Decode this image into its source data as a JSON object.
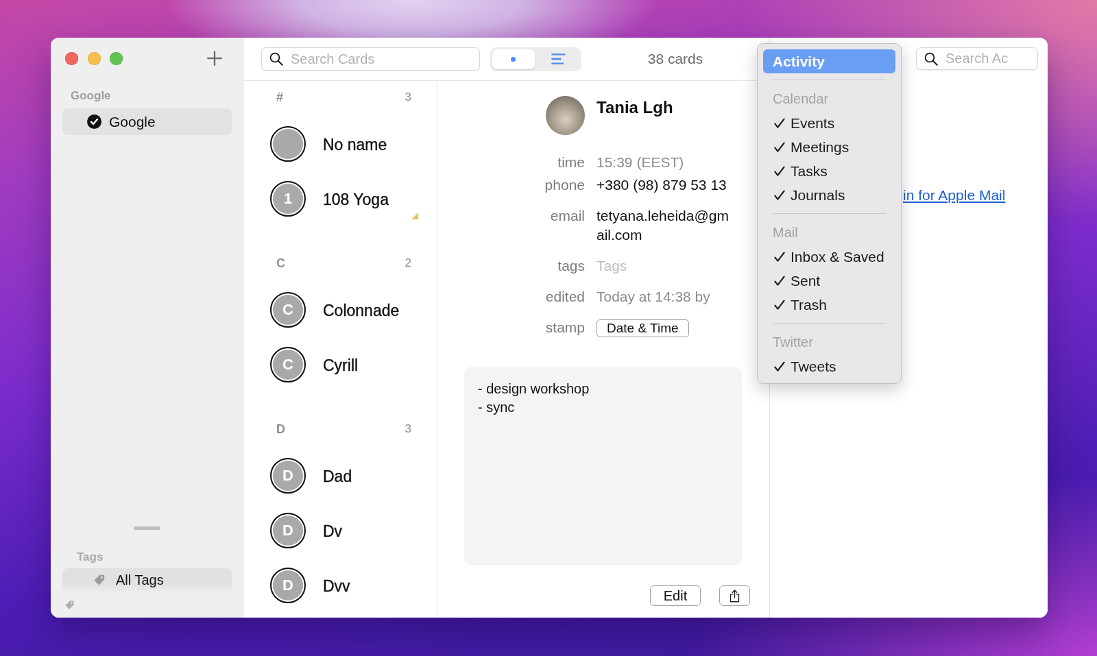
{
  "sidebar": {
    "accounts": {
      "title": "Google",
      "items": [
        {
          "label": "Google",
          "checked": true,
          "selected": true
        }
      ]
    },
    "tags": {
      "title": "Tags",
      "items": [
        {
          "label": "All Tags",
          "selected": true
        }
      ]
    }
  },
  "toolbar": {
    "search": {
      "placeholder": "Search Cards"
    },
    "view_modes": [
      {
        "kind": "dot",
        "selected": true
      },
      {
        "kind": "list",
        "selected": false
      }
    ],
    "count": "38 cards"
  },
  "card_list": {
    "sections": [
      {
        "letter": "#",
        "count": "3",
        "cards": [
          {
            "name": "No name",
            "marked": false
          },
          {
            "name": "108 Yoga",
            "initial": "1",
            "marked": true
          }
        ]
      },
      {
        "letter": "C",
        "count": "2",
        "cards": [
          {
            "name": "Colonnade",
            "initial": "C",
            "marked": false
          },
          {
            "name": "Cyrill",
            "initial": "C",
            "marked": false
          }
        ]
      },
      {
        "letter": "D",
        "count": "3",
        "cards": [
          {
            "name": "Dad",
            "initial": "D",
            "marked": false
          },
          {
            "name": "Dv",
            "initial": "D",
            "marked": false
          },
          {
            "name": "Dvv",
            "initial": "D",
            "marked": false
          }
        ]
      }
    ]
  },
  "detail": {
    "name": "Tania Lgh",
    "fields": [
      {
        "label": "time",
        "kind": "muted",
        "value": "15:39 (EEST)"
      },
      {
        "label": "phone",
        "kind": "text",
        "value": "+380 (98) 879 53 13"
      },
      {
        "label": "email",
        "kind": "text",
        "value": "tetyana.leheida@gmail.com"
      },
      {
        "label": "tags",
        "kind": "input",
        "placeholder": "Tags"
      },
      {
        "label": "edited",
        "kind": "muted",
        "value": "Today at 14:38 by"
      },
      {
        "label": "stamp",
        "kind": "button",
        "value": "Date & Time"
      }
    ],
    "notes": "- design workshop\n- sync",
    "buttons": [
      {
        "label": "Edit"
      }
    ]
  },
  "right_panel": {
    "search": {
      "placeholder": "Search Ac"
    },
    "link": "in for Apple Mail"
  },
  "menu": {
    "current": {
      "label": "Activity",
      "selected": true
    },
    "sections": [
      {
        "title": "Calendar",
        "items": [
          {
            "label": "Events",
            "checked": true
          },
          {
            "label": "Meetings",
            "checked": true
          },
          {
            "label": "Tasks",
            "checked": true
          },
          {
            "label": "Journals",
            "checked": true
          }
        ]
      },
      {
        "title": "Mail",
        "items": [
          {
            "label": "Inbox & Saved",
            "checked": true
          },
          {
            "label": "Sent",
            "checked": true
          },
          {
            "label": "Trash",
            "checked": true
          }
        ]
      },
      {
        "title": "Twitter",
        "items": [
          {
            "label": "Tweets",
            "checked": true
          }
        ]
      }
    ]
  }
}
